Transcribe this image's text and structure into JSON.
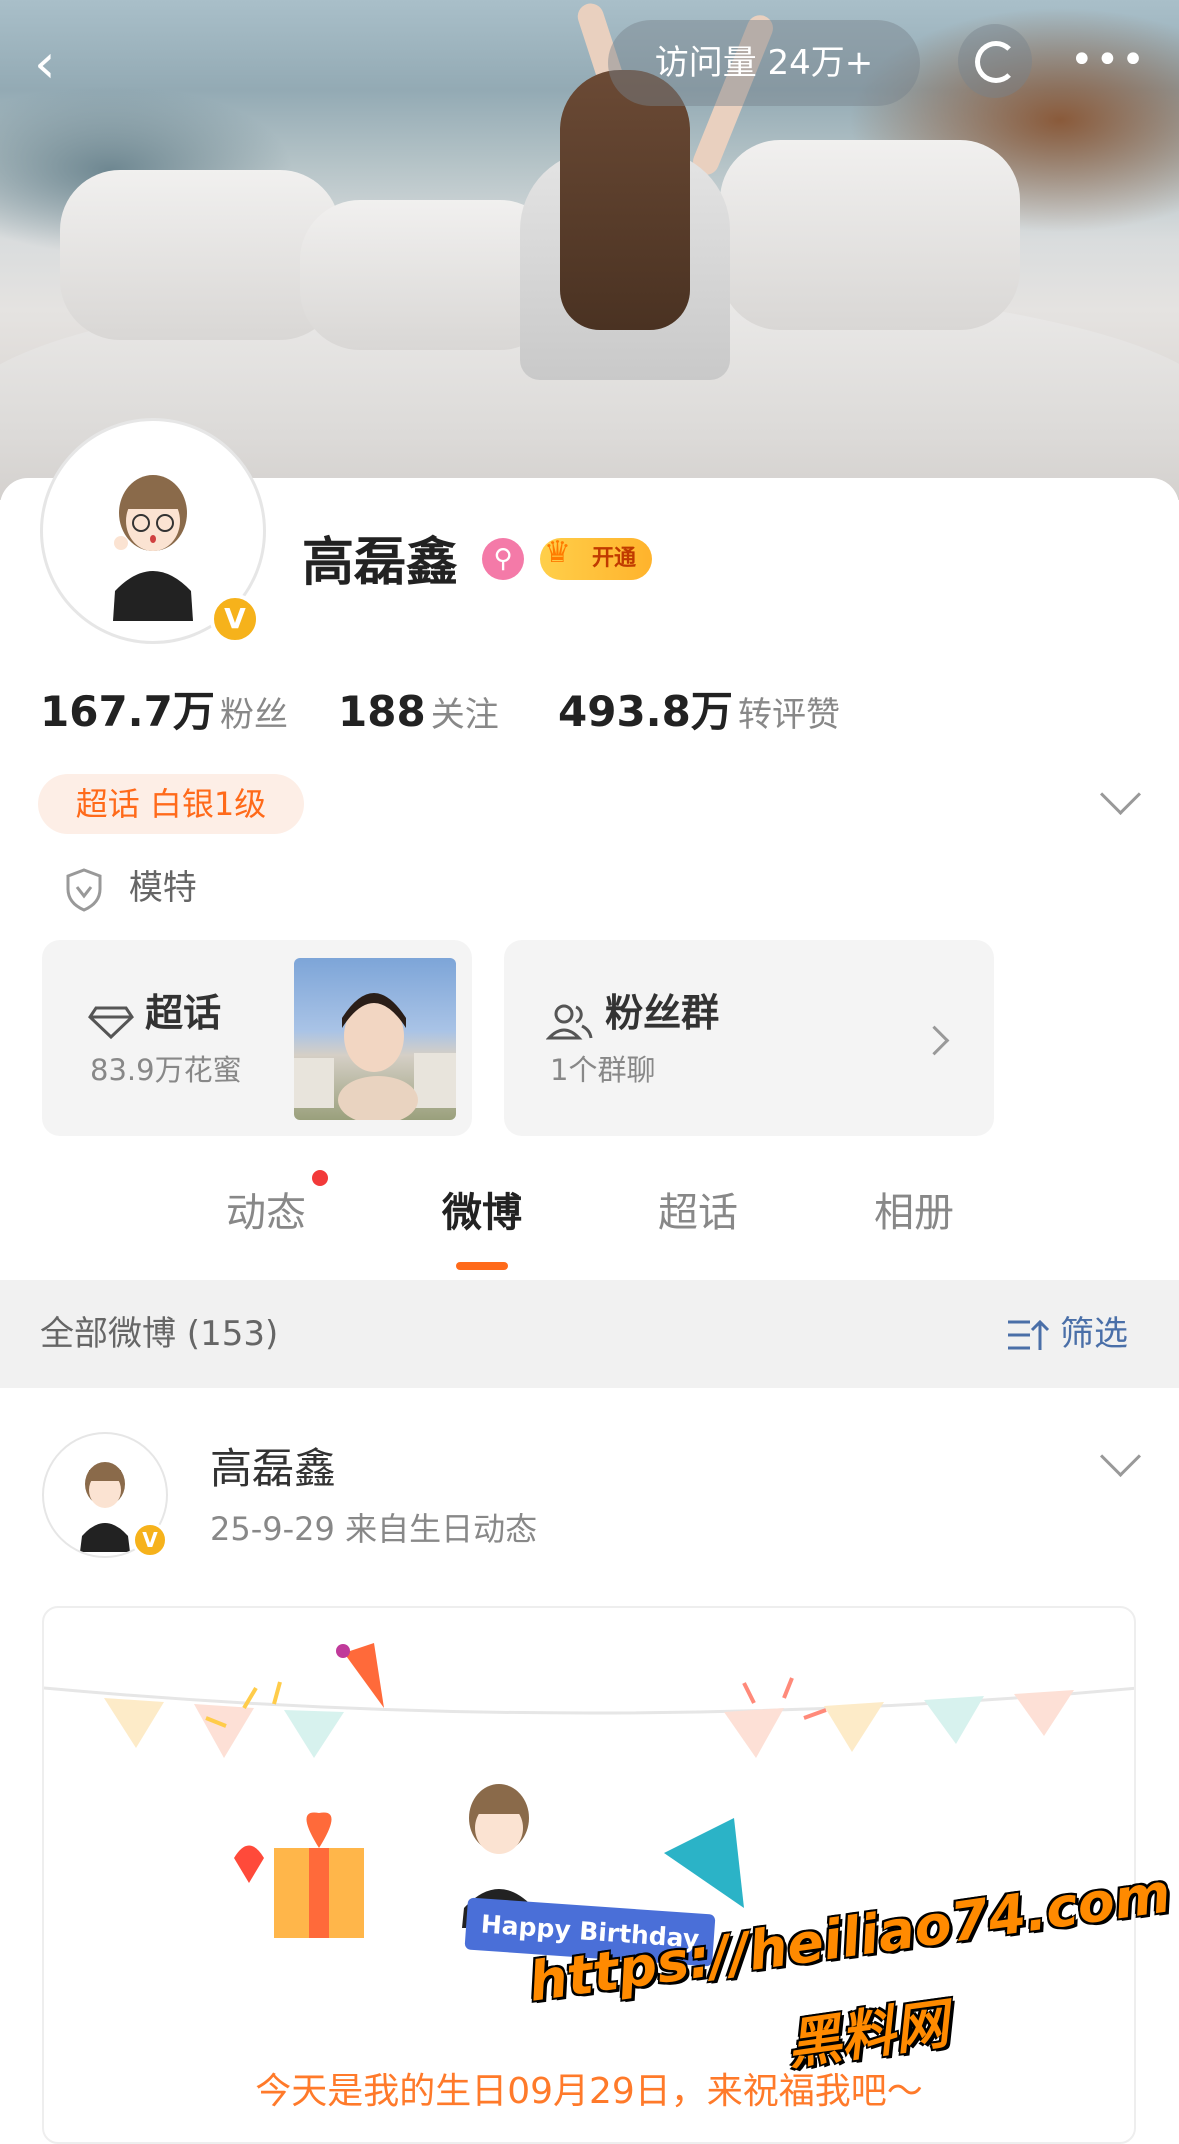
{
  "nav": {
    "back": "‹",
    "visits": "访问量 24万+",
    "more": "•••"
  },
  "profile": {
    "name": "高磊鑫",
    "gender_icon": "⚲",
    "vip_label": "开通",
    "verified": "V",
    "stats": [
      {
        "num": "167.7万",
        "label": "粉丝"
      },
      {
        "num": "188",
        "label": "关注"
      },
      {
        "num": "493.8万",
        "label": "转评赞"
      }
    ],
    "supertopic_level": "超话 白银1级",
    "occupation": "模特"
  },
  "tiles": {
    "supertopic": {
      "title": "超话",
      "sub": "83.9万花蜜"
    },
    "fan_group": {
      "title": "粉丝群",
      "sub": "1个群聊"
    }
  },
  "tabs": [
    "动态",
    "微博",
    "超话",
    "相册"
  ],
  "filter": {
    "label": "全部微博 (153)",
    "button": "筛选"
  },
  "post": {
    "author": "高磊鑫",
    "meta": "25-9-29  来自生日动态",
    "banner_text": "Happy Birthday",
    "caption": "今天是我的生日09月29日，来祝福我吧～"
  },
  "watermark": {
    "url": "https://heiliao74.com",
    "name": "黑料网"
  },
  "colors": {
    "accent": "#ff6a1a",
    "link": "#4a6fa8",
    "badge": "#f6b21b"
  }
}
